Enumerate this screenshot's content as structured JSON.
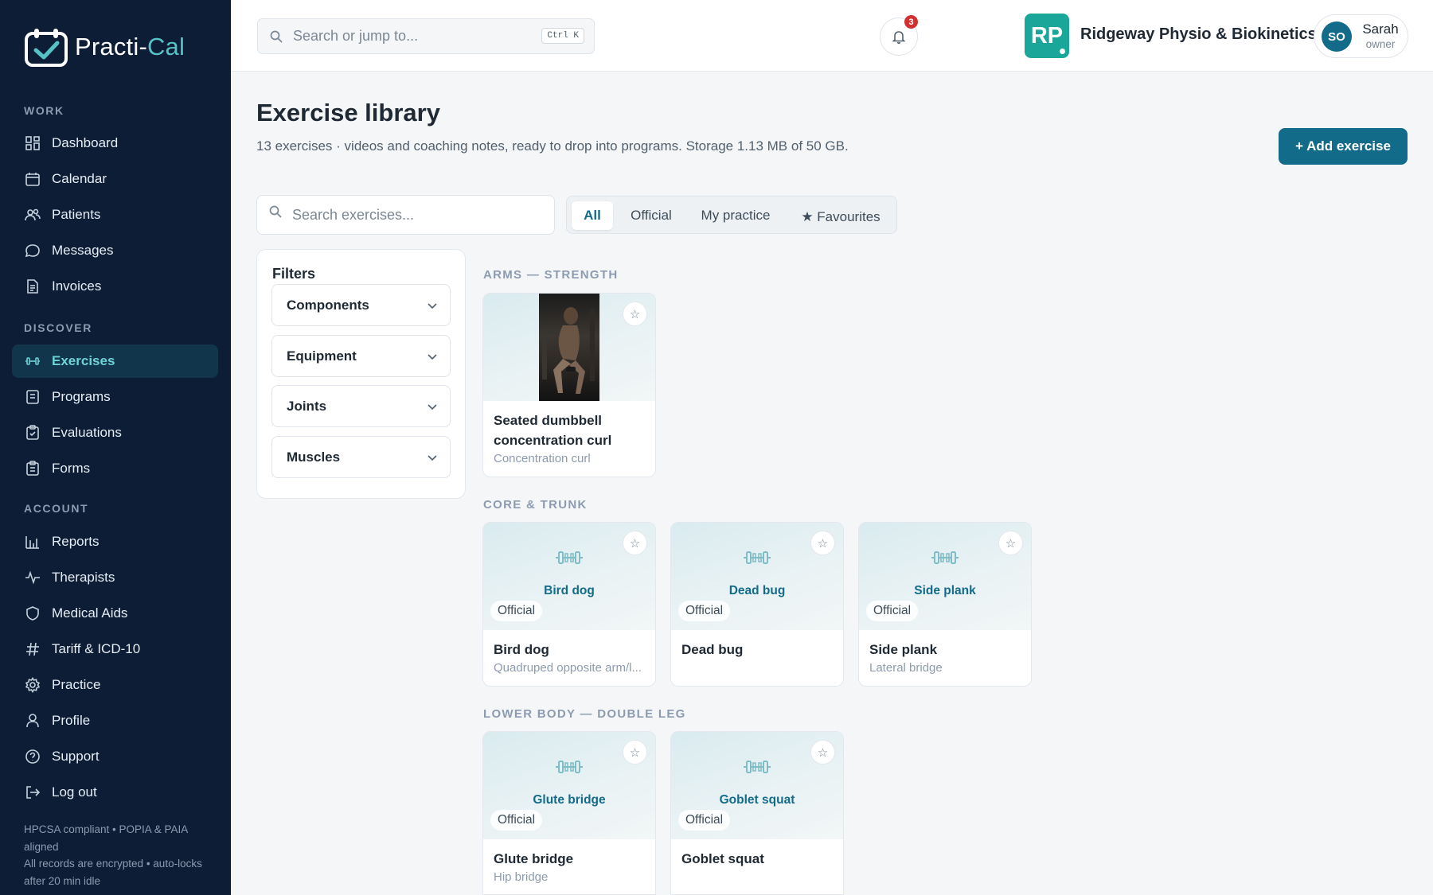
{
  "brand": {
    "name_main": "Practi-",
    "name_accent": "Cal"
  },
  "sidebar": {
    "sections": [
      {
        "label": "WORK",
        "items": [
          "Dashboard",
          "Calendar",
          "Patients",
          "Messages",
          "Invoices"
        ]
      },
      {
        "label": "DISCOVER",
        "items": [
          "Exercises",
          "Programs",
          "Evaluations",
          "Forms"
        ]
      },
      {
        "label": "ACCOUNT",
        "items": [
          "Reports",
          "Therapists",
          "Medical Aids",
          "Tariff & ICD-10",
          "Practice",
          "Profile",
          "Support",
          "Log out"
        ]
      }
    ],
    "active_item": "Exercises",
    "footer_line1": "HPCSA compliant • POPIA & PAIA aligned",
    "footer_line2": "All records are encrypted • auto-locks after 20 min idle"
  },
  "topbar": {
    "search_placeholder": "Search or jump to...",
    "shortcut": "Ctrl K",
    "notification_count": "3",
    "practice_initials": "RP",
    "practice_name": "Ridgeway Physio & Biokinetics",
    "user_initials": "SO",
    "user_name": "Sarah",
    "user_role": "owner"
  },
  "main": {
    "title": "Exercise library",
    "subtitle": "13 exercises · videos and coaching notes, ready to drop into programs. Storage 1.13 MB of 50 GB.",
    "add_button": "+ Add exercise",
    "search_placeholder": "Search exercises...",
    "tabs": [
      "All",
      "Official",
      "My practice",
      "★ Favourites"
    ],
    "active_tab": "All",
    "filters": {
      "title": "Filters",
      "options": [
        "Components",
        "Equipment",
        "Joints",
        "Muscles"
      ]
    },
    "categories": [
      {
        "label": "ARMS — STRENGTH",
        "cards": [
          {
            "title": "Seated dumbbell concentration curl",
            "subtitle": "Concentration curl",
            "has_photo": true
          }
        ]
      },
      {
        "label": "CORE & TRUNK",
        "cards": [
          {
            "thumb_label": "Bird dog",
            "badge": "Official",
            "title": "Bird dog",
            "subtitle": "Quadruped opposite arm/l..."
          },
          {
            "thumb_label": "Dead bug",
            "badge": "Official",
            "title": "Dead bug",
            "subtitle": ""
          },
          {
            "thumb_label": "Side plank",
            "badge": "Official",
            "title": "Side plank",
            "subtitle": "Lateral bridge"
          }
        ]
      },
      {
        "label": "LOWER BODY — DOUBLE LEG",
        "cards": [
          {
            "thumb_label": "Glute bridge",
            "badge": "Official",
            "title": "Glute bridge",
            "subtitle": "Hip bridge"
          },
          {
            "thumb_label": "Goblet squat",
            "badge": "Official",
            "title": "Goblet squat",
            "subtitle": ""
          }
        ]
      }
    ]
  },
  "colors": {
    "sidebar_bg": "#0c1d35",
    "accent": "#136b8a",
    "teal": "#55c2c5",
    "badge_red": "#d32f2f"
  }
}
